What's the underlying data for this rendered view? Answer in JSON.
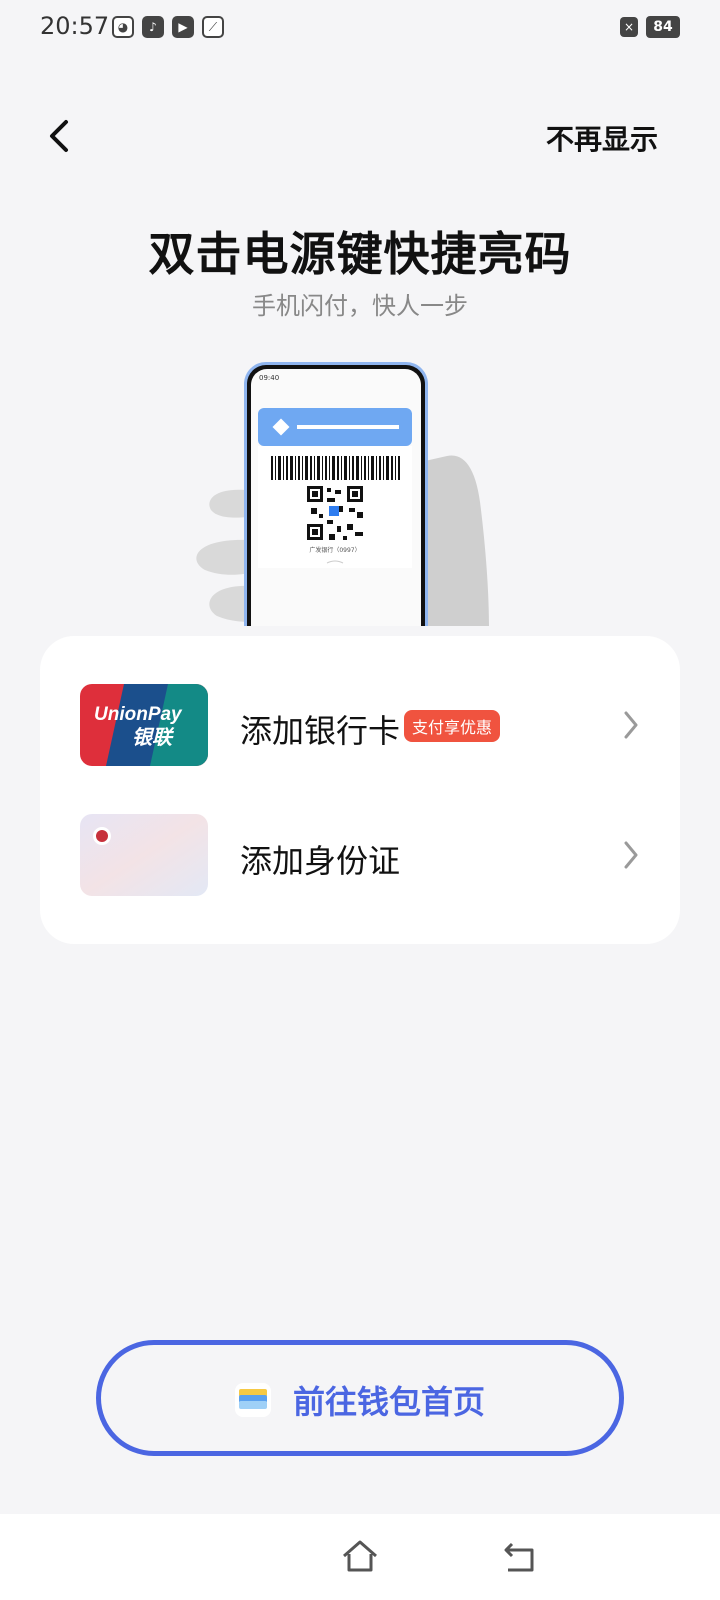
{
  "status_bar": {
    "time": "20:57",
    "battery": "84",
    "icons": [
      "cat-app-icon",
      "tiktok-icon",
      "video-app-icon",
      "leaf-app-icon"
    ],
    "close_badge": "×"
  },
  "header": {
    "dont_show_label": "不再显示"
  },
  "hero": {
    "title": "双击电源键快捷亮码",
    "subtitle": "手机闪付，快人一步"
  },
  "phone_mockup": {
    "clock": "09:40",
    "bank_caption": "广发银行（0997）"
  },
  "card_list": [
    {
      "label": "添加银行卡",
      "badge": "支付享优惠",
      "thumb_text": "UnionPay 银联"
    },
    {
      "label": "添加身份证",
      "badge": "",
      "thumb_text": ""
    }
  ],
  "wallet_button": {
    "label": "前往钱包首页"
  },
  "colors": {
    "accent": "#4b66e2",
    "promo": "#f0533f",
    "background": "#f5f5f7"
  }
}
